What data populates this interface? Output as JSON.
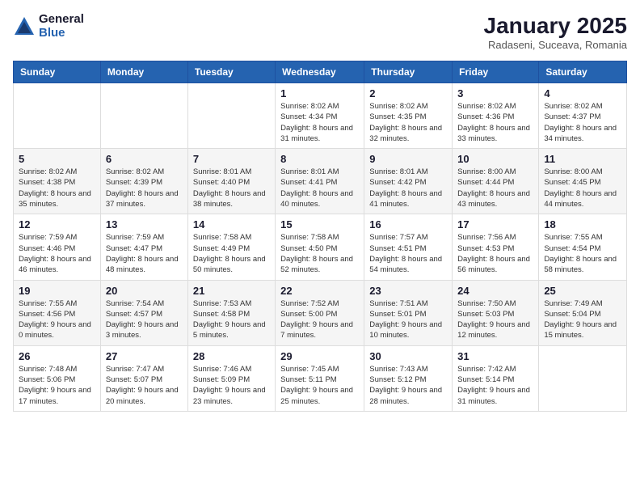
{
  "logo": {
    "general": "General",
    "blue": "Blue"
  },
  "title": "January 2025",
  "subtitle": "Radaseni, Suceava, Romania",
  "weekdays": [
    "Sunday",
    "Monday",
    "Tuesday",
    "Wednesday",
    "Thursday",
    "Friday",
    "Saturday"
  ],
  "weeks": [
    [
      {
        "day": "",
        "info": ""
      },
      {
        "day": "",
        "info": ""
      },
      {
        "day": "",
        "info": ""
      },
      {
        "day": "1",
        "info": "Sunrise: 8:02 AM\nSunset: 4:34 PM\nDaylight: 8 hours and 31 minutes."
      },
      {
        "day": "2",
        "info": "Sunrise: 8:02 AM\nSunset: 4:35 PM\nDaylight: 8 hours and 32 minutes."
      },
      {
        "day": "3",
        "info": "Sunrise: 8:02 AM\nSunset: 4:36 PM\nDaylight: 8 hours and 33 minutes."
      },
      {
        "day": "4",
        "info": "Sunrise: 8:02 AM\nSunset: 4:37 PM\nDaylight: 8 hours and 34 minutes."
      }
    ],
    [
      {
        "day": "5",
        "info": "Sunrise: 8:02 AM\nSunset: 4:38 PM\nDaylight: 8 hours and 35 minutes."
      },
      {
        "day": "6",
        "info": "Sunrise: 8:02 AM\nSunset: 4:39 PM\nDaylight: 8 hours and 37 minutes."
      },
      {
        "day": "7",
        "info": "Sunrise: 8:01 AM\nSunset: 4:40 PM\nDaylight: 8 hours and 38 minutes."
      },
      {
        "day": "8",
        "info": "Sunrise: 8:01 AM\nSunset: 4:41 PM\nDaylight: 8 hours and 40 minutes."
      },
      {
        "day": "9",
        "info": "Sunrise: 8:01 AM\nSunset: 4:42 PM\nDaylight: 8 hours and 41 minutes."
      },
      {
        "day": "10",
        "info": "Sunrise: 8:00 AM\nSunset: 4:44 PM\nDaylight: 8 hours and 43 minutes."
      },
      {
        "day": "11",
        "info": "Sunrise: 8:00 AM\nSunset: 4:45 PM\nDaylight: 8 hours and 44 minutes."
      }
    ],
    [
      {
        "day": "12",
        "info": "Sunrise: 7:59 AM\nSunset: 4:46 PM\nDaylight: 8 hours and 46 minutes."
      },
      {
        "day": "13",
        "info": "Sunrise: 7:59 AM\nSunset: 4:47 PM\nDaylight: 8 hours and 48 minutes."
      },
      {
        "day": "14",
        "info": "Sunrise: 7:58 AM\nSunset: 4:49 PM\nDaylight: 8 hours and 50 minutes."
      },
      {
        "day": "15",
        "info": "Sunrise: 7:58 AM\nSunset: 4:50 PM\nDaylight: 8 hours and 52 minutes."
      },
      {
        "day": "16",
        "info": "Sunrise: 7:57 AM\nSunset: 4:51 PM\nDaylight: 8 hours and 54 minutes."
      },
      {
        "day": "17",
        "info": "Sunrise: 7:56 AM\nSunset: 4:53 PM\nDaylight: 8 hours and 56 minutes."
      },
      {
        "day": "18",
        "info": "Sunrise: 7:55 AM\nSunset: 4:54 PM\nDaylight: 8 hours and 58 minutes."
      }
    ],
    [
      {
        "day": "19",
        "info": "Sunrise: 7:55 AM\nSunset: 4:56 PM\nDaylight: 9 hours and 0 minutes."
      },
      {
        "day": "20",
        "info": "Sunrise: 7:54 AM\nSunset: 4:57 PM\nDaylight: 9 hours and 3 minutes."
      },
      {
        "day": "21",
        "info": "Sunrise: 7:53 AM\nSunset: 4:58 PM\nDaylight: 9 hours and 5 minutes."
      },
      {
        "day": "22",
        "info": "Sunrise: 7:52 AM\nSunset: 5:00 PM\nDaylight: 9 hours and 7 minutes."
      },
      {
        "day": "23",
        "info": "Sunrise: 7:51 AM\nSunset: 5:01 PM\nDaylight: 9 hours and 10 minutes."
      },
      {
        "day": "24",
        "info": "Sunrise: 7:50 AM\nSunset: 5:03 PM\nDaylight: 9 hours and 12 minutes."
      },
      {
        "day": "25",
        "info": "Sunrise: 7:49 AM\nSunset: 5:04 PM\nDaylight: 9 hours and 15 minutes."
      }
    ],
    [
      {
        "day": "26",
        "info": "Sunrise: 7:48 AM\nSunset: 5:06 PM\nDaylight: 9 hours and 17 minutes."
      },
      {
        "day": "27",
        "info": "Sunrise: 7:47 AM\nSunset: 5:07 PM\nDaylight: 9 hours and 20 minutes."
      },
      {
        "day": "28",
        "info": "Sunrise: 7:46 AM\nSunset: 5:09 PM\nDaylight: 9 hours and 23 minutes."
      },
      {
        "day": "29",
        "info": "Sunrise: 7:45 AM\nSunset: 5:11 PM\nDaylight: 9 hours and 25 minutes."
      },
      {
        "day": "30",
        "info": "Sunrise: 7:43 AM\nSunset: 5:12 PM\nDaylight: 9 hours and 28 minutes."
      },
      {
        "day": "31",
        "info": "Sunrise: 7:42 AM\nSunset: 5:14 PM\nDaylight: 9 hours and 31 minutes."
      },
      {
        "day": "",
        "info": ""
      }
    ]
  ]
}
